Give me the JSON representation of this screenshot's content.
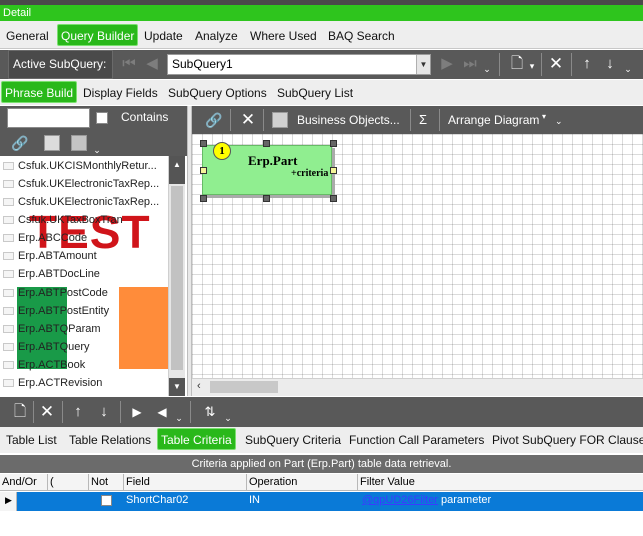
{
  "window": {
    "title": "Detail"
  },
  "main_tabs": [
    "General",
    "Query Builder",
    "Update",
    "Analyze",
    "Where Used",
    "BAQ Search"
  ],
  "subquery_bar": {
    "label": "Active SubQuery:",
    "selected": "SubQuery1"
  },
  "sub_tabs": [
    "Phrase Build",
    "Display Fields",
    "SubQuery Options",
    "SubQuery List"
  ],
  "search": {
    "value": "",
    "contains_label": "Contains",
    "contains_checked": false
  },
  "table_list": [
    "Csfuk.UKCISMonthlyRetur...",
    "Csfuk.UKElectronicTaxRep...",
    "Csfuk.UKElectronicTaxRep...",
    "Csfuk.UKTaxBoxTran",
    "Erp.ABCCode",
    "Erp.ABTAmount",
    "Erp.ABTDocLine",
    "Erp.ABTPostCode",
    "Erp.ABTPostEntity",
    "Erp.ABTQParam",
    "Erp.ABTQuery",
    "Erp.ACTBook",
    "Erp.ACTRevision"
  ],
  "watermark": {
    "text": "TEST",
    "color": "#d0141a"
  },
  "flag_colors": {
    "green": "#199a48",
    "white": "#ffffff",
    "orange": "#ff8c3a"
  },
  "diagram_toolbar": {
    "business_objects": "Business Objects...",
    "sigma": "Σ",
    "arrange": "Arrange Diagram"
  },
  "diagram_node": {
    "number": "1",
    "title": "Erp.Part",
    "subtitle": "+criteria",
    "fill": "#90ee90",
    "badge_color": "#ffff00"
  },
  "bottom_tabs": [
    "Table List",
    "Table Relations",
    "Table Criteria",
    "SubQuery Criteria",
    "Function Call Parameters",
    "Pivot SubQuery FOR Clause"
  ],
  "criteria": {
    "caption": "Criteria applied on Part (Erp.Part)  table data retrieval.",
    "columns": [
      "And/Or",
      "(",
      "Not",
      "Field",
      "Operation",
      "Filter Value"
    ],
    "rows": [
      {
        "andor": "",
        "paren": "",
        "not": false,
        "field": "ShortChar02",
        "operation": "IN",
        "filter_link": "@qpUD26Filter",
        "filter_suffix": "parameter"
      }
    ]
  },
  "colors": {
    "accent_green": "#2ec51d",
    "toolbar_dark": "#595959",
    "selection_blue": "#0a7ad7"
  }
}
